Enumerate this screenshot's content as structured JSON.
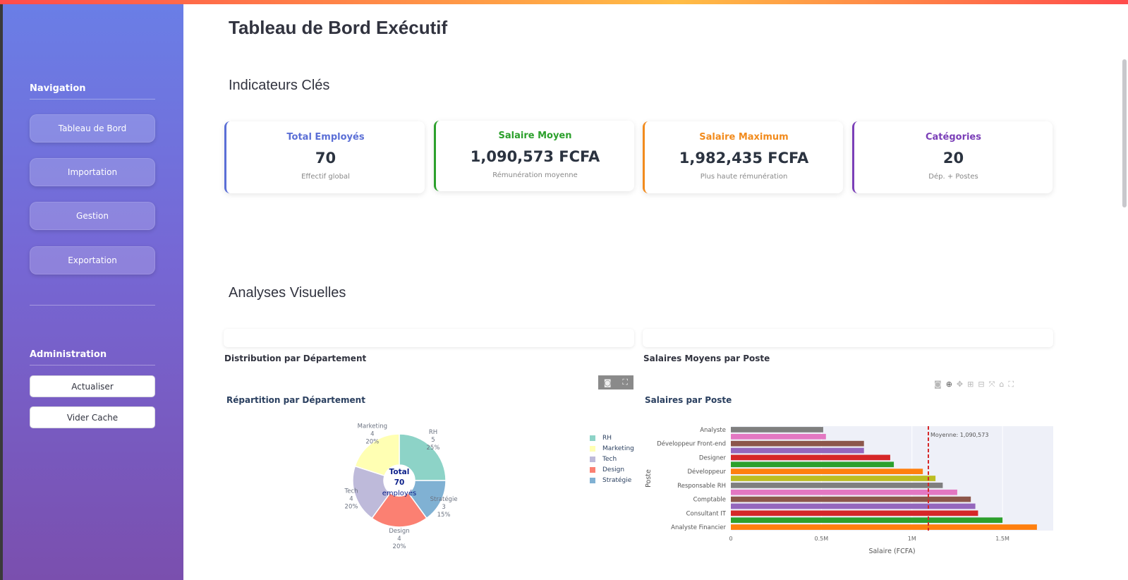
{
  "sidebar": {
    "nav_heading": "Navigation",
    "nav_items": [
      "Tableau de Bord",
      "Importation",
      "Gestion",
      "Exportation"
    ],
    "admin_heading": "Administration",
    "admin_buttons": [
      "Actualiser",
      "Vider Cache"
    ]
  },
  "main": {
    "title": "Tableau de Bord Exécutif",
    "kpi_heading": "Indicateurs Clés",
    "kpis": [
      {
        "title": "Total Employés",
        "value": "70",
        "subtitle": "Effectif global",
        "color": "#5b6fd6"
      },
      {
        "title": "Salaire Moyen",
        "value": "1,090,573 FCFA",
        "subtitle": "Rémunération moyenne",
        "color": "#2ca02c"
      },
      {
        "title": "Salaire Maximum",
        "value": "1,982,435 FCFA",
        "subtitle": "Plus haute rémunération",
        "color": "#f28b1d"
      },
      {
        "title": "Catégories",
        "value": "20",
        "subtitle": "Dép. + Postes",
        "color": "#7b3fb8"
      }
    ],
    "visual_heading": "Analyses Visuelles",
    "left_subheading": "Distribution par Département",
    "right_subheading": "Salaires Moyens par Poste"
  },
  "chart_data": [
    {
      "type": "pie",
      "title": "Répartition par Département",
      "center_text": [
        "Total",
        "70",
        "employés"
      ],
      "slices": [
        {
          "label": "RH",
          "value": 5,
          "percent": "25%",
          "color": "#8dd3c7"
        },
        {
          "label": "Stratégie",
          "value": 3,
          "percent": "15%",
          "color": "#80b1d3"
        },
        {
          "label": "Design",
          "value": 4,
          "percent": "20%",
          "color": "#fb8072"
        },
        {
          "label": "Tech",
          "value": 4,
          "percent": "20%",
          "color": "#bebada"
        },
        {
          "label": "Marketing",
          "value": 4,
          "percent": "20%",
          "color": "#ffffb3"
        }
      ],
      "legend": [
        "RH",
        "Marketing",
        "Tech",
        "Design",
        "Stratégie"
      ],
      "legend_placement": "right"
    },
    {
      "type": "bar",
      "orientation": "horizontal",
      "title": "Salaires par Poste",
      "xlabel": "Salaire (FCFA)",
      "ylabel": "Poste",
      "xlim": [
        0,
        1780000
      ],
      "x_ticks": [
        "0",
        "0.5M",
        "1M",
        "1.5M"
      ],
      "x_tick_values": [
        0,
        500000,
        1000000,
        1500000
      ],
      "y_tick_labels": [
        "Analyste",
        "Développeur Front-end",
        "Designer",
        "Développeur",
        "Responsable RH",
        "Comptable",
        "Consultant IT",
        "Analyste Financier"
      ],
      "y_tick_positions": [
        0,
        2,
        4,
        6,
        8,
        10,
        12,
        14
      ],
      "mean_line": {
        "value": 1090573,
        "label": "Moyenne: 1,090,573",
        "color": "#d62728"
      },
      "bars": [
        {
          "value": 510000,
          "color": "#7f7f7f"
        },
        {
          "value": 525000,
          "color": "#e377c2"
        },
        {
          "value": 735000,
          "color": "#8c564b"
        },
        {
          "value": 735000,
          "color": "#9467bd"
        },
        {
          "value": 880000,
          "color": "#d62728"
        },
        {
          "value": 900000,
          "color": "#2ca02c"
        },
        {
          "value": 1060000,
          "color": "#ff7f0e"
        },
        {
          "value": 1130000,
          "color": "#bcbd22"
        },
        {
          "value": 1170000,
          "color": "#7f7f7f"
        },
        {
          "value": 1250000,
          "color": "#e377c2"
        },
        {
          "value": 1325000,
          "color": "#8c564b"
        },
        {
          "value": 1350000,
          "color": "#9467bd"
        },
        {
          "value": 1365000,
          "color": "#d62728"
        },
        {
          "value": 1500000,
          "color": "#2ca02c"
        },
        {
          "value": 1690000,
          "color": "#ff7f0e"
        }
      ],
      "grid": true
    }
  ]
}
